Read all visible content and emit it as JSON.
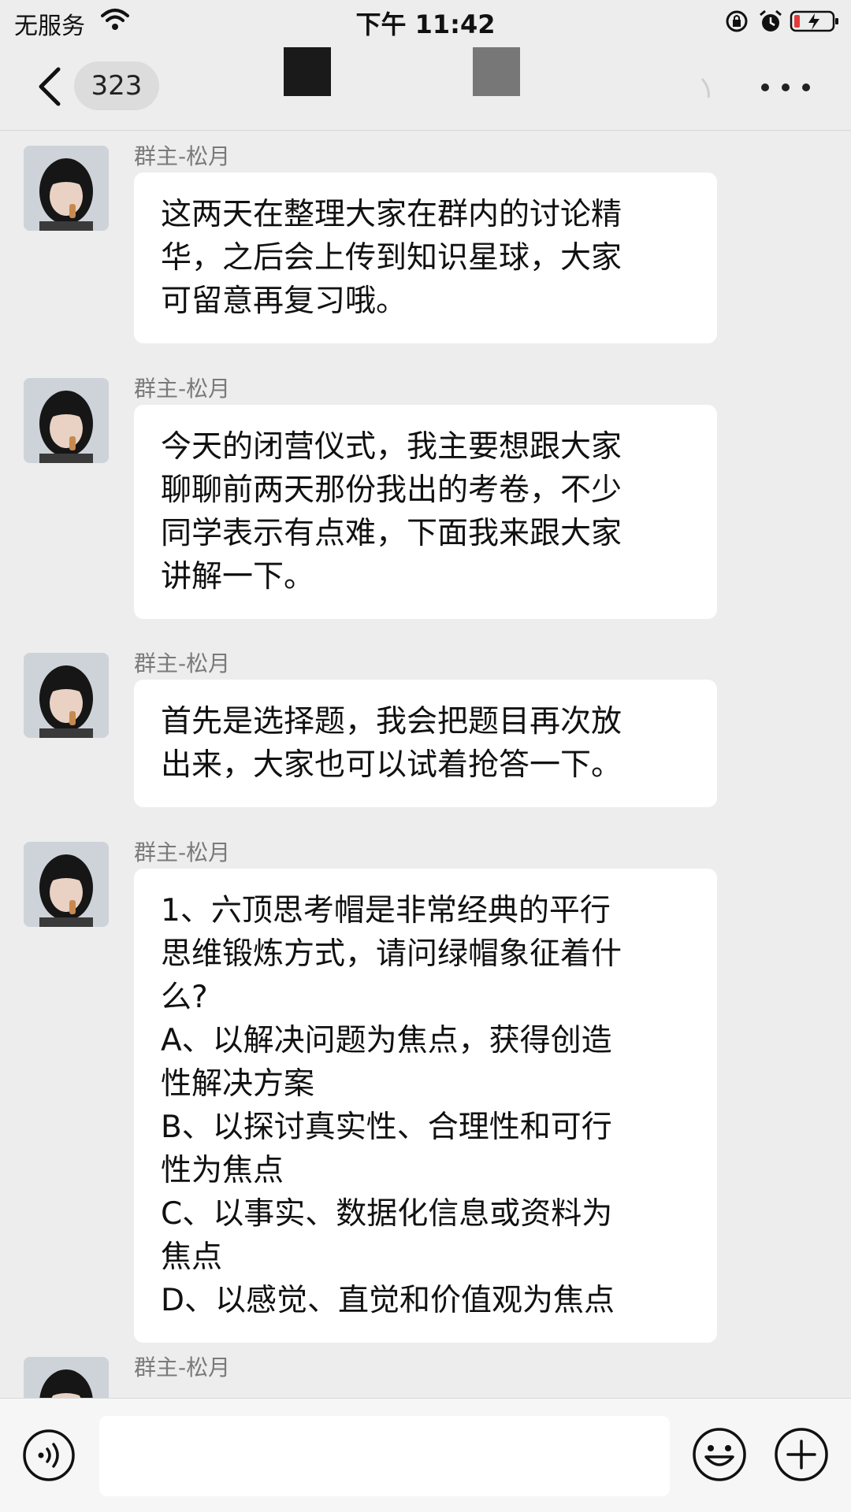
{
  "status_bar": {
    "carrier": "无服务",
    "time": "下午 11:42",
    "icons": [
      "wifi-icon",
      "rotation-lock-icon",
      "alarm-icon",
      "battery-charging-icon"
    ]
  },
  "nav": {
    "unread_count": "323",
    "icons": [
      "back-chevron-icon",
      "more-dots-icon"
    ]
  },
  "messages": [
    {
      "sender": "群主-松月",
      "text": "这两天在整理大家在群内的讨论精\n华，之后会上传到知识星球，大家\n可留意再复习哦。"
    },
    {
      "sender": "群主-松月",
      "text": "今天的闭营仪式，我主要想跟大家\n聊聊前两天那份我出的考卷，不少\n同学表示有点难，下面我来跟大家\n讲解一下。"
    },
    {
      "sender": "群主-松月",
      "text": "首先是选择题，我会把题目再次放\n出来，大家也可以试着抢答一下。"
    },
    {
      "sender": "群主-松月",
      "text": "1、六顶思考帽是非常经典的平行\n思维锻炼方式，请问绿帽象征着什\n么?\nA、以解决问题为焦点，获得创造\n性解决方案\nB、以探讨真实性、合理性和可行\n性为焦点\nC、以事实、数据化信息或资料为\n焦点\nD、以感觉、直觉和价值观为焦点"
    },
    {
      "sender": "群主-松月",
      "text": ""
    }
  ],
  "input_bar": {
    "value": "",
    "icons": [
      "voice-icon",
      "emoji-icon",
      "plus-icon"
    ]
  },
  "colors": {
    "background": "#ededed",
    "bubble": "#ffffff",
    "sender_text": "#7a7a7a",
    "battery_low": "#e23b3b"
  }
}
